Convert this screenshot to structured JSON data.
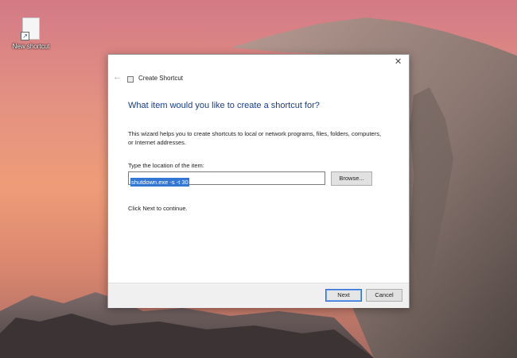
{
  "desktop": {
    "shortcut_label": "New shortcut"
  },
  "dialog": {
    "title": "Create Shortcut",
    "back_icon": "back-arrow-icon",
    "close_icon": "close-icon",
    "heading": "What item would you like to create a shortcut for?",
    "description": "This wizard helps you to create shortcuts to local or network programs, files, folders, computers, or Internet addresses.",
    "location_label": "Type the location of the item:",
    "location_value": "shutdown.exe -s -t 30",
    "browse_label": "Browse...",
    "continue_text": "Click Next to continue.",
    "next_label": "Next",
    "cancel_label": "Cancel"
  },
  "colors": {
    "heading": "#1a3c8c",
    "selection": "#3277d6",
    "default_button_border": "#2f6fd6"
  }
}
